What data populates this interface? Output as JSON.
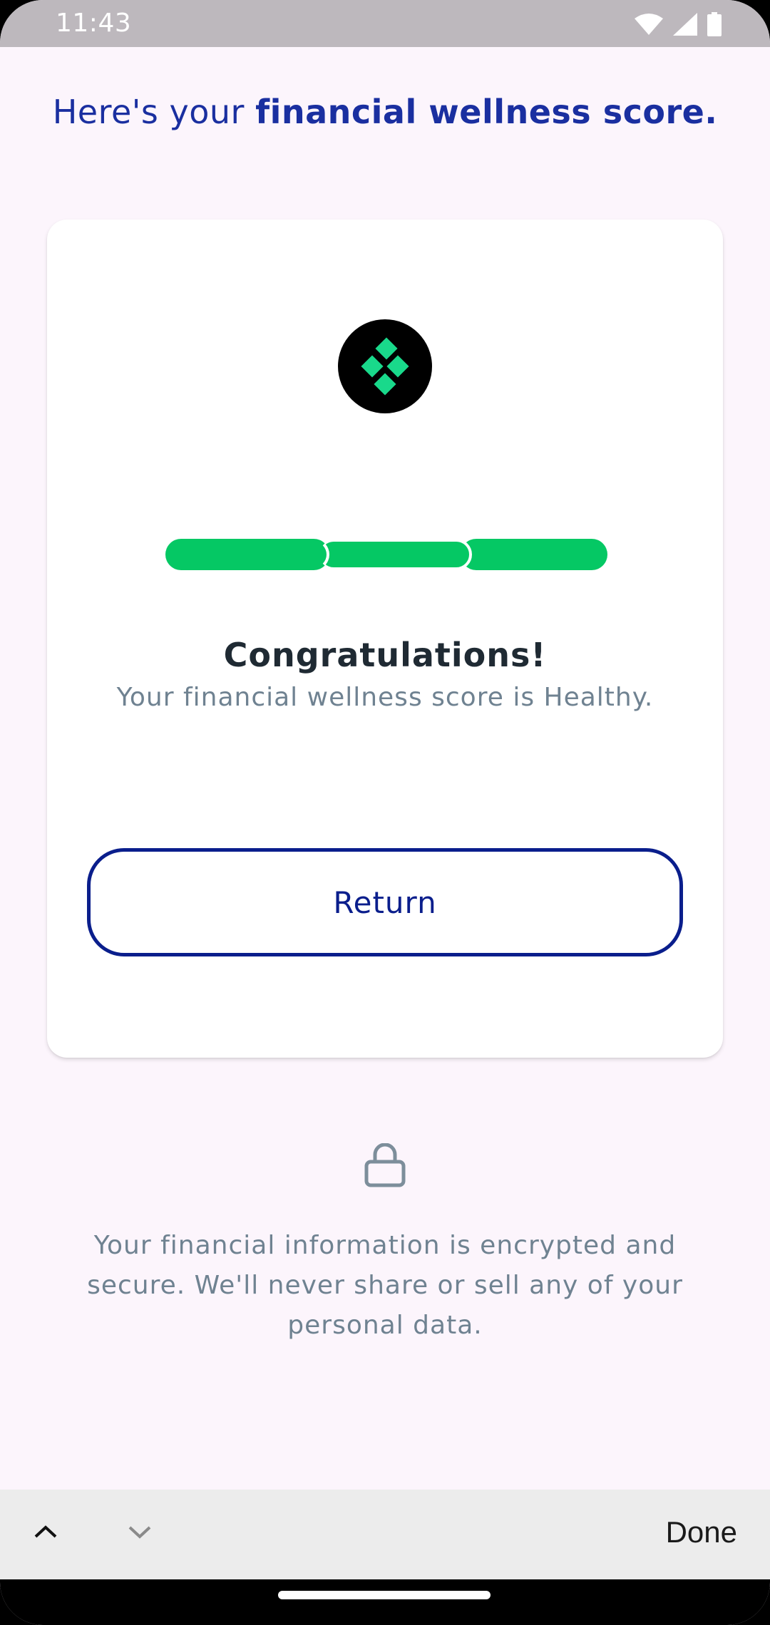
{
  "status_bar": {
    "time": "11:43",
    "icons": [
      "wifi-icon",
      "signal-icon",
      "battery-icon"
    ]
  },
  "headline": {
    "prefix": "Here's your ",
    "emphasis": "financial wellness score."
  },
  "card": {
    "logo_icon": "diamond-grid-icon",
    "meter": {
      "segments_total": 3,
      "segments_filled": 3,
      "fill_color": "#05c864"
    },
    "title": "Congratulations!",
    "subtitle": "Your financial wellness score is Healthy.",
    "return_label": "Return"
  },
  "security": {
    "icon": "lock-icon",
    "text": "Your financial information is encrypted and secure. We'll never share or sell any of your personal data."
  },
  "accessory_bar": {
    "prev_icon": "chevron-up-icon",
    "next_icon": "chevron-down-icon",
    "done_label": "Done"
  },
  "colors": {
    "brand_blue": "#1a2fa0",
    "button_blue": "#0a1e8c",
    "meter_green": "#05c864",
    "muted_text": "#6f8291",
    "background": "#fcf5fc"
  }
}
